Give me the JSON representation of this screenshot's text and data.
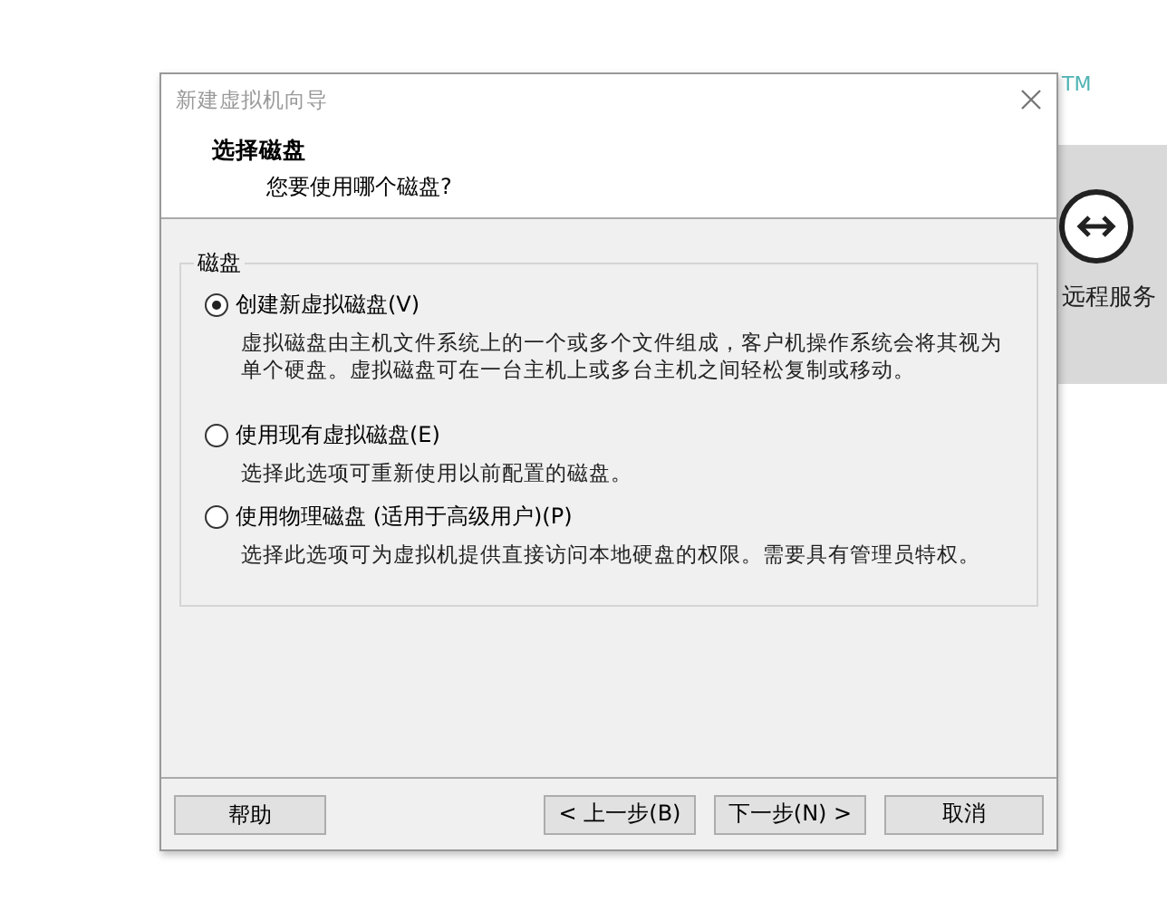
{
  "background_app": {
    "trademark": "TM",
    "tile_label": "远程服务"
  },
  "window": {
    "title": "新建虚拟机向导"
  },
  "header": {
    "title": "选择磁盘",
    "subtitle": "您要使用哪个磁盘?"
  },
  "group": {
    "label": "磁盘",
    "options": [
      {
        "label": "创建新虚拟磁盘(V)",
        "description": "虚拟磁盘由主机文件系统上的一个或多个文件组成，客户机操作系统会将其视为单个硬盘。虚拟磁盘可在一台主机上或多台主机之间轻松复制或移动。",
        "selected": true
      },
      {
        "label": "使用现有虚拟磁盘(E)",
        "description": "选择此选项可重新使用以前配置的磁盘。",
        "selected": false
      },
      {
        "label": "使用物理磁盘 (适用于高级用户)(P)",
        "description": "选择此选项可为虚拟机提供直接访问本地硬盘的权限。需要具有管理员特权。",
        "selected": false
      }
    ]
  },
  "buttons": {
    "left": [
      "帮助"
    ],
    "right": [
      "< 上一步(B)",
      "下一步(N) >",
      "取消"
    ]
  }
}
